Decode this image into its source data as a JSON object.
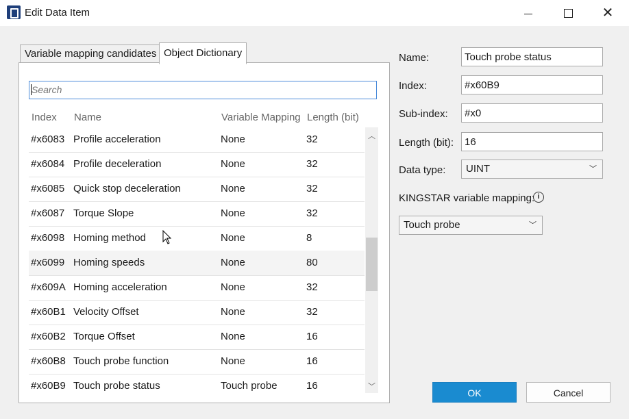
{
  "window": {
    "title": "Edit Data Item",
    "controls": {
      "minimize": "",
      "maximize": "",
      "close": "✕"
    }
  },
  "tabs": [
    {
      "label": "Variable mapping candidates",
      "active": false
    },
    {
      "label": "Object Dictionary",
      "active": true
    }
  ],
  "search": {
    "placeholder": "Search",
    "value": ""
  },
  "table": {
    "columns": [
      "Index",
      "Name",
      "Variable Mapping",
      "Length (bit)"
    ],
    "rows": [
      {
        "index": "#x6083",
        "name": "Profile acceleration",
        "mapping": "None",
        "length": "32"
      },
      {
        "index": "#x6084",
        "name": "Profile deceleration",
        "mapping": "None",
        "length": "32"
      },
      {
        "index": "#x6085",
        "name": "Quick stop deceleration",
        "mapping": "None",
        "length": "32"
      },
      {
        "index": "#x6087",
        "name": "Torque Slope",
        "mapping": "None",
        "length": "32"
      },
      {
        "index": "#x6098",
        "name": "Homing method",
        "mapping": "None",
        "length": "8"
      },
      {
        "index": "#x6099",
        "name": "Homing speeds",
        "mapping": "None",
        "length": "80"
      },
      {
        "index": "#x609A",
        "name": "Homing acceleration",
        "mapping": "None",
        "length": "32"
      },
      {
        "index": "#x60B1",
        "name": "Velocity Offset",
        "mapping": "None",
        "length": "32"
      },
      {
        "index": "#x60B2",
        "name": "Torque Offset",
        "mapping": "None",
        "length": "16"
      },
      {
        "index": "#x60B8",
        "name": "Touch probe function",
        "mapping": "None",
        "length": "16"
      },
      {
        "index": "#x60B9",
        "name": "Touch probe status",
        "mapping": "Touch probe",
        "length": "16"
      }
    ]
  },
  "details": {
    "name_label": "Name:",
    "name_value": "Touch probe status",
    "index_label": "Index:",
    "index_value": "#x60B9",
    "subindex_label": "Sub-index:",
    "subindex_value": "#x0",
    "length_label": "Length (bit):",
    "length_value": "16",
    "datatype_label": "Data type:",
    "datatype_value": "UINT",
    "mapping_label": "KINGSTAR variable mapping:",
    "mapping_value": "Touch probe",
    "info_icon": "i"
  },
  "buttons": {
    "ok": "OK",
    "cancel": "Cancel"
  },
  "colors": {
    "accent": "#1a8bd0",
    "search_border": "#4a8ad9"
  }
}
